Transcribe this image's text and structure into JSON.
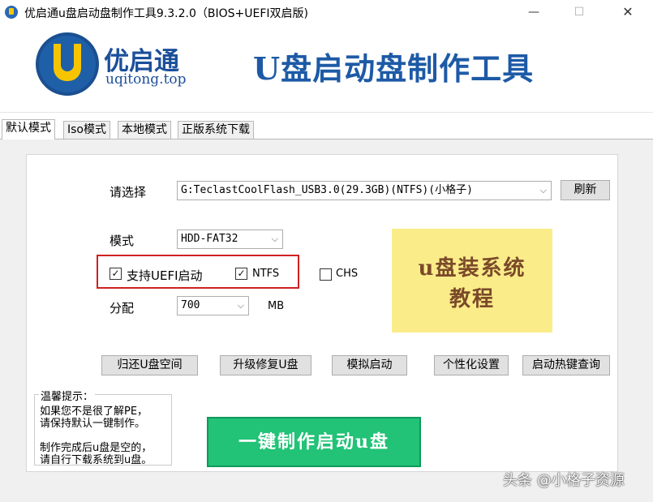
{
  "window": {
    "title": "优启通u盘启动盘制作工具9.3.2.0（BIOS+UEFI双启版)",
    "minimize": "—",
    "maximize": "☐",
    "close": "✕"
  },
  "banner": {
    "logo_name": "优启通",
    "logo_url": "uqitong.top",
    "title": "U盘启动盘制作工具"
  },
  "tabs": [
    "默认模式",
    "Iso模式",
    "本地模式",
    "正版系统下载"
  ],
  "form": {
    "select_label": "请选择",
    "device_value": "G:TeclastCoolFlash_USB3.0(29.3GB)(NTFS)(小格子)",
    "refresh_button": "刷新",
    "mode_label": "模式",
    "mode_value": "HDD-FAT32",
    "uefi_checkbox": "支持UEFI启动",
    "uefi_checked": true,
    "ntfs_checkbox": "NTFS",
    "ntfs_checked": true,
    "chs_checkbox": "CHS",
    "chs_checked": false,
    "alloc_label": "分配",
    "alloc_value": "700",
    "alloc_unit": "MB"
  },
  "promo": {
    "line1": "u盘装系统",
    "line2": "教程"
  },
  "actions": [
    "归还U盘空间",
    "升级修复U盘",
    "模拟启动",
    "个性化设置",
    "启动热键查询"
  ],
  "tips": {
    "title": "温馨提示：",
    "line1": "如果您不是很了解PE，",
    "line2": "请保持默认一键制作。",
    "line3": "制作完成后u盘是空的，",
    "line4": "请自行下载系统到u盘。"
  },
  "main_button": "一键制作启动u盘",
  "watermark": "头条 @小格子资源"
}
